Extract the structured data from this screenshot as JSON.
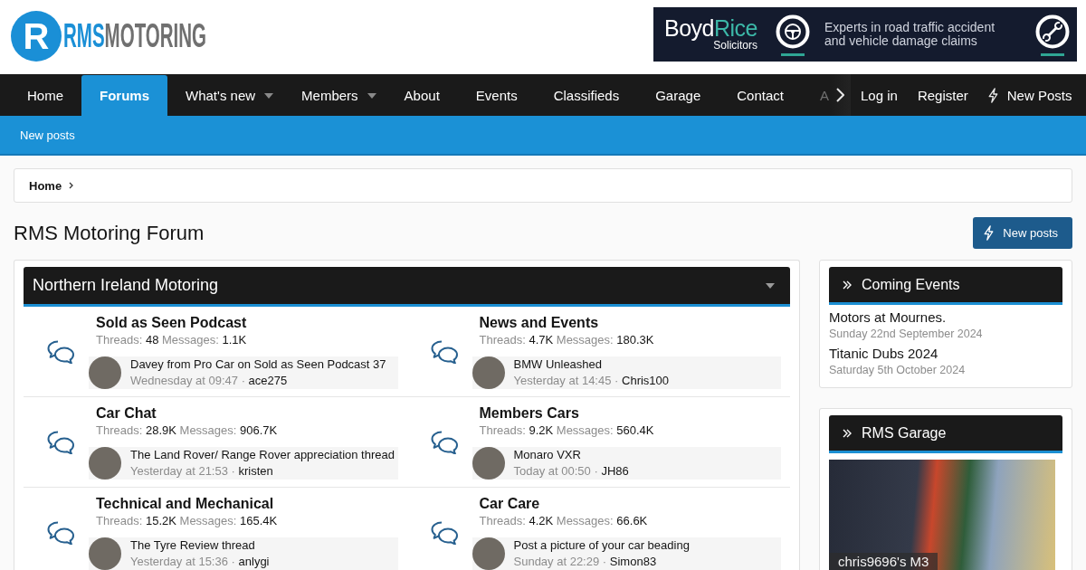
{
  "header": {
    "logo": {
      "mark": "R",
      "name_first": "RMS",
      "name_second": "MOTORING"
    },
    "ad_banner": {
      "brand_first": "Boyd",
      "brand_second": "Rice",
      "brand_sub": "Solicitors",
      "tagline_lines": [
        "Experts in road traffic accident",
        "and vehicle damage claims"
      ]
    }
  },
  "nav": {
    "tabs": [
      {
        "label": "Home",
        "selected": false,
        "has_menu": false
      },
      {
        "label": "Forums",
        "selected": true,
        "has_menu": false
      },
      {
        "label": "What's new",
        "selected": false,
        "has_menu": true
      },
      {
        "label": "Members",
        "selected": false,
        "has_menu": true
      },
      {
        "label": "About",
        "selected": false,
        "has_menu": false
      },
      {
        "label": "Events",
        "selected": false,
        "has_menu": false
      },
      {
        "label": "Classifieds",
        "selected": false,
        "has_menu": false
      },
      {
        "label": "Garage",
        "selected": false,
        "has_menu": false
      },
      {
        "label": "Contact",
        "selected": false,
        "has_menu": false
      }
    ],
    "cut_off_tab": "A",
    "account_links": [
      {
        "label": "Log in",
        "kind": "text"
      },
      {
        "label": "Register",
        "kind": "text"
      },
      {
        "label": "New Posts",
        "kind": "icon"
      }
    ]
  },
  "sub_nav": {
    "links": [
      "New posts"
    ]
  },
  "breadcrumb": [
    "Home"
  ],
  "page_title": "RMS Motoring Forum",
  "new_posts_button": "New posts",
  "category": {
    "title": "Northern Ireland Motoring",
    "forums": [
      {
        "title": "Sold as Seen Podcast",
        "stats": [
          {
            "label": "Threads:",
            "value": "48"
          },
          {
            "label": "Messages:",
            "value": "1.1K"
          }
        ],
        "last_post": {
          "title": "Davey from Pro Car on Sold as Seen Podcast 37",
          "time": "Wednesday at 09:47",
          "separator": "·",
          "author": "ace275"
        }
      },
      {
        "title": "News and Events",
        "stats": [
          {
            "label": "Threads:",
            "value": "4.7K"
          },
          {
            "label": "Messages:",
            "value": "180.3K"
          }
        ],
        "last_post": {
          "title": "BMW Unleashed",
          "time": "Yesterday at 14:45",
          "separator": "·",
          "author": "Chris100"
        }
      },
      {
        "title": "Car Chat",
        "stats": [
          {
            "label": "Threads:",
            "value": "28.9K"
          },
          {
            "label": "Messages:",
            "value": "906.7K"
          }
        ],
        "last_post": {
          "title": "The Land Rover/ Range Rover appreciation thread",
          "time": "Yesterday at 21:53",
          "separator": "·",
          "author": "kristen"
        }
      },
      {
        "title": "Members Cars",
        "stats": [
          {
            "label": "Threads:",
            "value": "9.2K"
          },
          {
            "label": "Messages:",
            "value": "560.4K"
          }
        ],
        "last_post": {
          "title": "Monaro VXR",
          "time": "Today at 00:50",
          "separator": "·",
          "author": "JH86"
        }
      },
      {
        "title": "Technical and Mechanical",
        "stats": [
          {
            "label": "Threads:",
            "value": "15.2K"
          },
          {
            "label": "Messages:",
            "value": "165.4K"
          }
        ],
        "last_post": {
          "title": "The Tyre Review thread",
          "time": "Yesterday at 15:36",
          "separator": "·",
          "author": "anlygi"
        }
      },
      {
        "title": "Car Care",
        "stats": [
          {
            "label": "Threads:",
            "value": "4.2K"
          },
          {
            "label": "Messages:",
            "value": "66.6K"
          }
        ],
        "last_post": {
          "title": "Post a picture of your car beading",
          "time": "Sunday at 22:29",
          "separator": "·",
          "author": "Simon83"
        }
      }
    ]
  },
  "sidebar": {
    "widgets": [
      {
        "kind": "events",
        "title": "Coming Events",
        "events": [
          {
            "name": "Motors at Mournes.",
            "date": "Sunday 22nd September 2024"
          },
          {
            "name": "Titanic Dubs 2024",
            "date": "Saturday 5th October 2024"
          }
        ]
      },
      {
        "kind": "garage",
        "title": "RMS Garage",
        "photo_caption": "chris9696's M3"
      }
    ]
  }
}
